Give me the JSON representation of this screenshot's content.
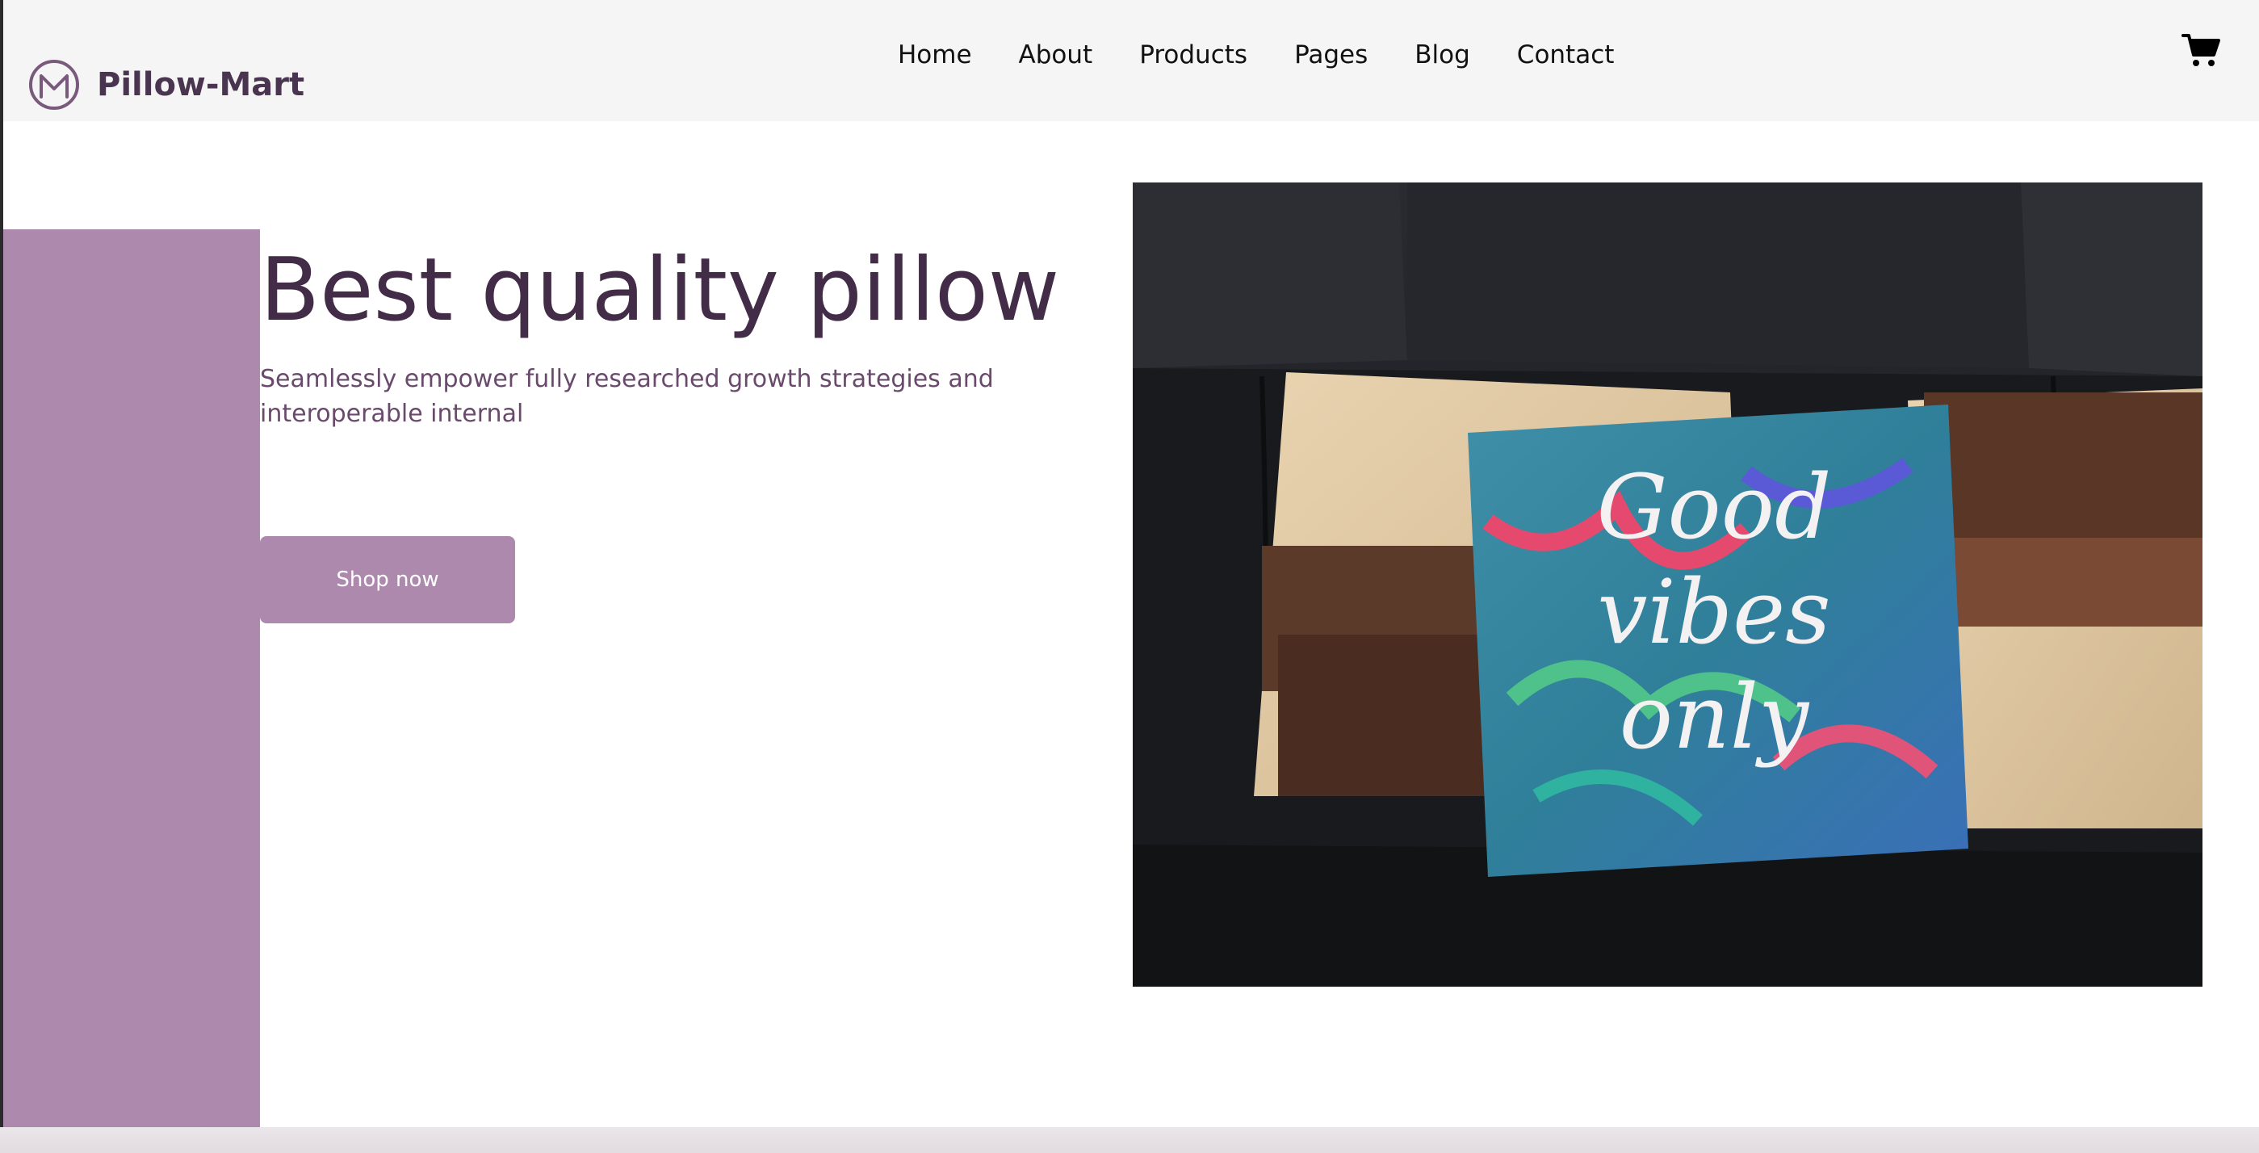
{
  "brand": {
    "name": "Pillow-Mart",
    "logo_icon": "m-circle-logo-icon"
  },
  "nav": {
    "items": [
      {
        "label": "Home"
      },
      {
        "label": "About"
      },
      {
        "label": "Products"
      },
      {
        "label": "Pages"
      },
      {
        "label": "Blog"
      },
      {
        "label": "Contact"
      }
    ],
    "cart_icon": "shopping-cart-icon"
  },
  "hero": {
    "title": "Best quality pillow",
    "subtitle": "Seamlessly empower fully researched growth strategies and interoperable internal",
    "cta_label": "Shop now",
    "image_text": "Good vibes only"
  },
  "colors": {
    "accent": "#ad89ae",
    "heading": "#432c47",
    "subtitle": "#6a4a6c",
    "nav_background": "#f5f5f5"
  }
}
